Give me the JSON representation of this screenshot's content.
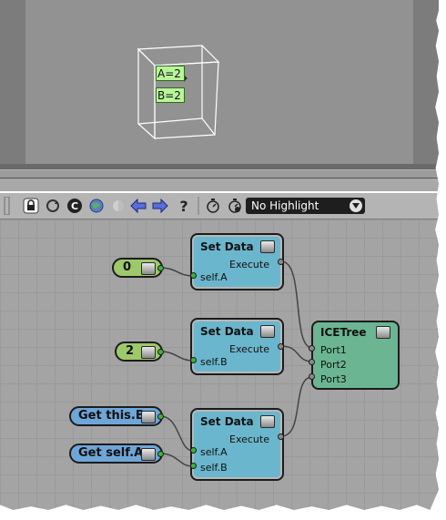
{
  "toolbar": {
    "highlight_select": "No Highlight",
    "icons": [
      "lock-icon",
      "refresh-icon",
      "compact-icon",
      "globe-icon",
      "disabled-icon",
      "back-arrow-icon",
      "forward-arrow-icon",
      "help-icon",
      "timer-icon",
      "timer-icon-2"
    ]
  },
  "viewport": {
    "tags": [
      "A=2",
      "B=2"
    ]
  },
  "nodes": {
    "value_zero": "0",
    "value_two": "2",
    "get_this_b": "Get this.B",
    "get_self_a": "Get self.A",
    "set_data_1": {
      "title": "Set Data",
      "execute": "Execute",
      "port": "self.A"
    },
    "set_data_2": {
      "title": "Set Data",
      "execute": "Execute",
      "port": "self.B"
    },
    "set_data_3": {
      "title": "Set Data",
      "execute": "Execute",
      "port_a": "self.A",
      "port_b": "self.B"
    },
    "icetree": {
      "title": "ICETree",
      "ports": [
        "Port1",
        "Port2",
        "Port3"
      ]
    }
  },
  "colors": {
    "set_data": "#6ab6cd",
    "icetree": "#6bb592",
    "value_green": "#9ec96a",
    "get_blue": "#6fa6d8",
    "graph_bg": "#a4a4a4"
  }
}
